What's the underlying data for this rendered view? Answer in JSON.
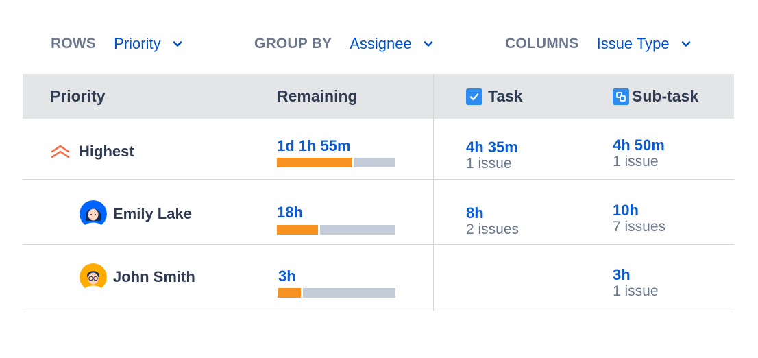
{
  "controls": {
    "rows": {
      "label": "ROWS",
      "value": "Priority"
    },
    "group_by": {
      "label": "GROUP BY",
      "value": "Assignee"
    },
    "columns": {
      "label": "COLUMNS",
      "value": "Issue Type"
    }
  },
  "table": {
    "headers": {
      "priority": "Priority",
      "remaining": "Remaining",
      "task": "Task",
      "subtask": "Sub-task"
    },
    "rows": [
      {
        "name": "Highest",
        "remaining": "1d 1h 55m",
        "progress": 0.64,
        "task": {
          "time": "4h 35m",
          "count": "1 issue"
        },
        "subtask": {
          "time": "4h 50m",
          "count": "1 issue"
        }
      },
      {
        "name": "Emily Lake",
        "remaining": "18h",
        "progress": 0.35,
        "task": {
          "time": "8h",
          "count": "2 issues"
        },
        "subtask": {
          "time": "10h",
          "count": "7 issues"
        }
      },
      {
        "name": "John Smith",
        "remaining": "3h",
        "progress": 0.2,
        "task": {
          "time": "",
          "count": ""
        },
        "subtask": {
          "time": "3h",
          "count": "1 issue"
        }
      }
    ]
  },
  "colors": {
    "accent": "#0052cc",
    "bar_fill": "#f79220",
    "bar_rest": "#c5ccd9",
    "priority_highest": "#f2734a"
  },
  "icons": {
    "priority": "double-chevron-up-icon",
    "task": "checkbox-icon",
    "subtask": "subtask-icon",
    "dropdown": "chevron-down-icon"
  }
}
